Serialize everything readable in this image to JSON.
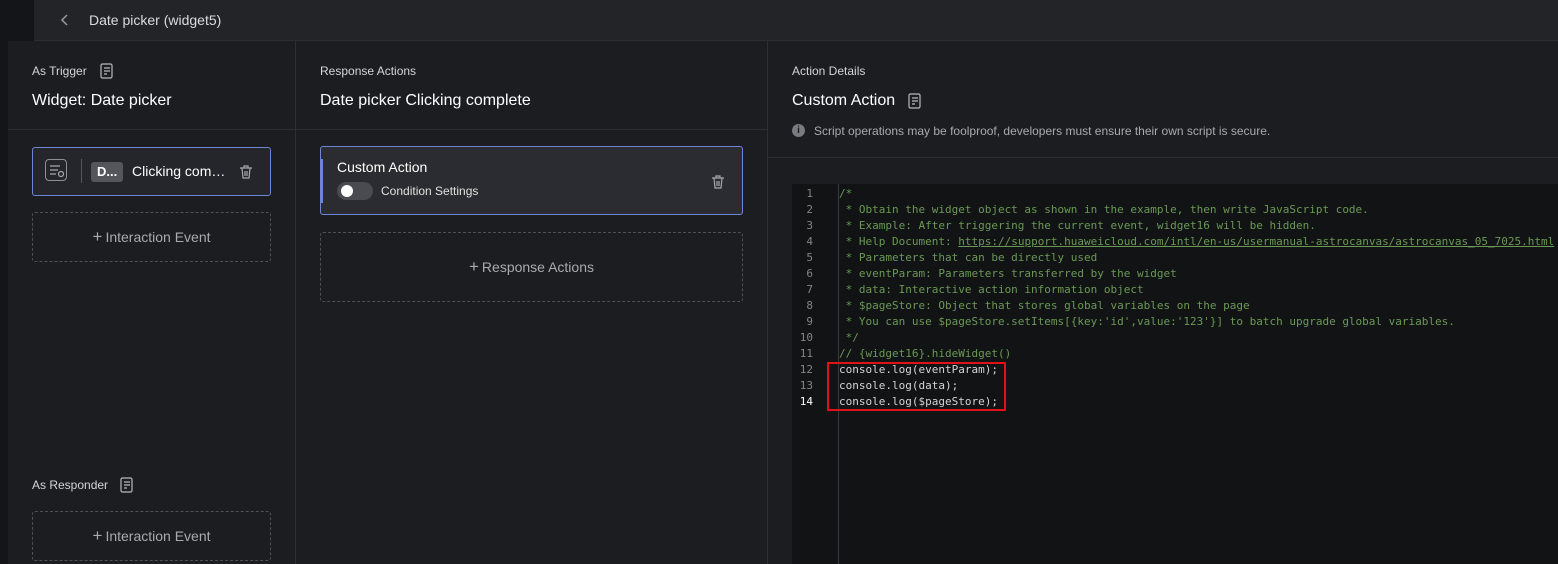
{
  "topbar": {
    "title": "Date picker (widget5)"
  },
  "trigger": {
    "section_label": "As Trigger",
    "widget_title": "Widget: Date picker",
    "event_tag": "D...",
    "event_label": "Clicking complete",
    "add_event_label": "Interaction Event"
  },
  "responder": {
    "section_label": "As Responder",
    "add_event_label": "Interaction Event"
  },
  "response": {
    "section_label": "Response Actions",
    "title": "Date picker Clicking complete",
    "action_name": "Custom Action",
    "condition_label": "Condition Settings",
    "add_action_label": "Response Actions"
  },
  "details": {
    "section_label": "Action Details",
    "title": "Custom Action",
    "info_text": "Script operations may be foolproof, developers must ensure their own script is secure."
  },
  "editor": {
    "active_line": 14,
    "lines": [
      "/*",
      " * Obtain the widget object as shown in the example, then write JavaScript code.",
      " * Example: After triggering the current event, widget16 will be hidden.",
      " * Help Document: ",
      " * Parameters that can be directly used",
      " * eventParam: Parameters transferred by the widget",
      " * data: Interactive action information object",
      " * $pageStore: Object that stores global variables on the page",
      " * You can use $pageStore.setItems[{key:'id',value:'123'}] to batch upgrade global variables.",
      " */",
      "// {widget16}.hideWidget()",
      "console.log(eventParam);",
      "console.log(data);",
      "console.log($pageStore);"
    ],
    "help_link": "https://support.huaweicloud.com/intl/en-us/usermanual-astrocanvas/astrocanvas_05_7025.html"
  }
}
